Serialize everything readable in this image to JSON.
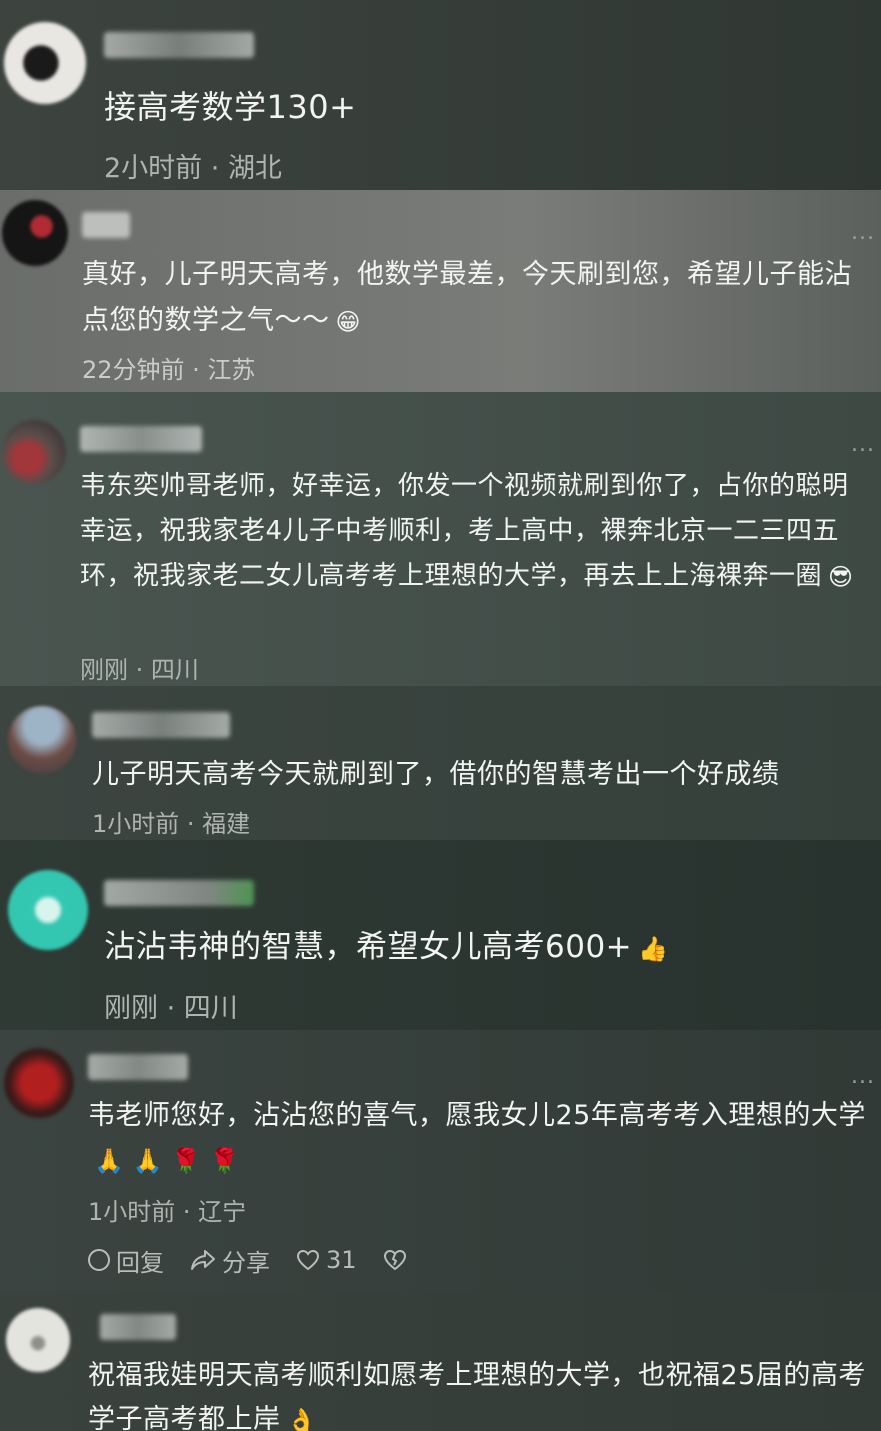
{
  "comments": [
    {
      "text": "接高考数学130+",
      "time": "2小时前",
      "region": "湖北",
      "emoji": ""
    },
    {
      "text": "真好，儿子明天高考，他数学最差，今天刷到您，希望儿子能沾点您的数学之气～～",
      "time": "22分钟前",
      "region": "江苏",
      "emoji": "😁",
      "more": "..."
    },
    {
      "text": "韦东奕帅哥老师，好幸运，你发一个视频就刷到你了，占你的聪明幸运，祝我家老4儿子中考顺利，考上高中，裸奔北京一二三四五环，祝我家老二女儿高考考上理想的大学，再去上上海裸奔一圈",
      "time": "刚刚",
      "region": "四川",
      "emoji": "😎",
      "more": "..."
    },
    {
      "text": "儿子明天高考今天就刷到了，借你的智慧考出一个好成绩",
      "time": "1小时前",
      "region": "福建",
      "emoji": ""
    },
    {
      "text": "沾沾韦神的智慧，希望女儿高考600+",
      "time": "刚刚",
      "region": "四川",
      "emoji": "👍"
    },
    {
      "text": "韦老师您好，沾沾您的喜气，愿我女儿25年高考考入理想的大学",
      "time": "1小时前",
      "region": "辽宁",
      "emoji": "🙏 🙏 🌹 🌹",
      "more": "..."
    },
    {
      "text": "祝福我娃明天高考顺利如愿考上理想的大学，也祝福25届的高考学子高考都上岸",
      "time": "",
      "region": "",
      "emoji": "👌"
    }
  ],
  "actions": {
    "reply": "回复",
    "share": "分享",
    "likes": "31"
  },
  "separator": " · "
}
